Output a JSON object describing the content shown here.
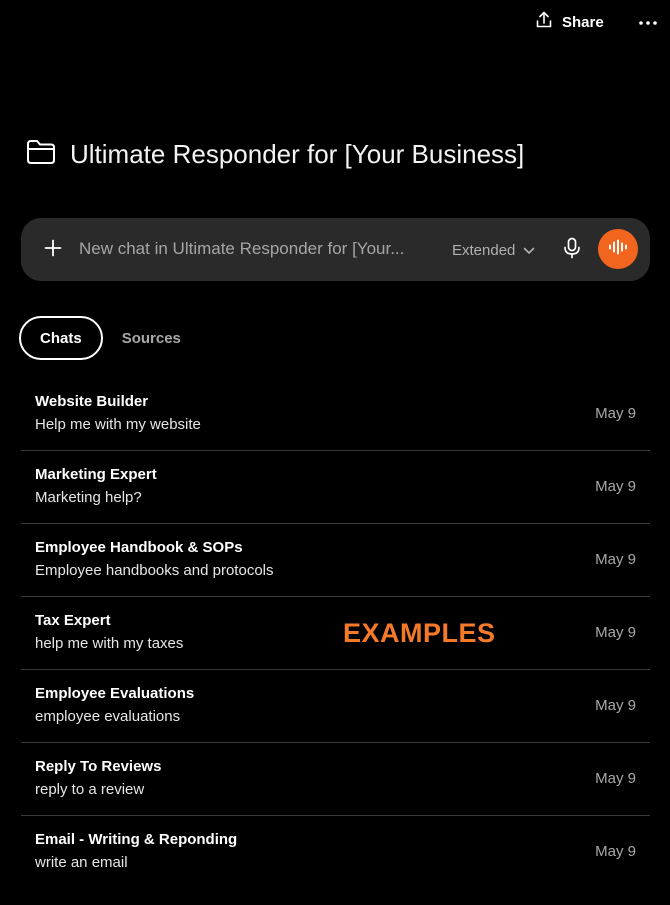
{
  "header": {
    "share_label": "Share",
    "share_icon": "share-upload-icon",
    "more_icon": "more-horizontal-icon"
  },
  "project": {
    "title": "Ultimate Responder for [Your Business]",
    "icon": "folder-icon"
  },
  "composer": {
    "placeholder": "New chat in Ultimate Responder for [Your...",
    "value": "",
    "mode_label": "Extended",
    "add_icon": "plus-icon",
    "mode_icon": "chevron-down-icon",
    "mic_icon": "microphone-icon",
    "voice_icon": "voice-waveform-icon",
    "voice_color": "#f1651f"
  },
  "tabs": [
    {
      "label": "Chats",
      "active": true
    },
    {
      "label": "Sources",
      "active": false
    }
  ],
  "chats": [
    {
      "title": "Website Builder",
      "subtitle": "Help me with my website",
      "date": "May 9"
    },
    {
      "title": "Marketing Expert",
      "subtitle": "Marketing help?",
      "date": "May 9"
    },
    {
      "title": "Employee Handbook & SOPs",
      "subtitle": "Employee handbooks and protocols",
      "date": "May 9"
    },
    {
      "title": "Tax Expert",
      "subtitle": "help me with my taxes",
      "date": "May 9"
    },
    {
      "title": "Employee Evaluations",
      "subtitle": "employee evaluations",
      "date": "May 9"
    },
    {
      "title": "Reply To Reviews",
      "subtitle": "reply to a review",
      "date": "May 9"
    },
    {
      "title": "Email - Writing & Reponding",
      "subtitle": "write an email",
      "date": "May 9"
    }
  ],
  "overlay": {
    "label": "EXAMPLES",
    "color": "#f47a2a"
  }
}
